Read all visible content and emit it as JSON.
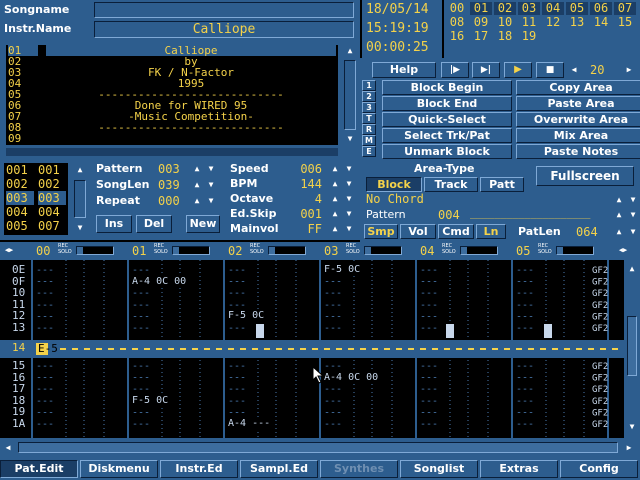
{
  "header": {
    "songname_label": "Songname",
    "instrname_label": "Instr.Name",
    "instr_name_value": "Calliope",
    "date": "18/05/14",
    "time": "15:19:19",
    "elapsed": "00:00:25",
    "channels_row1": [
      "00",
      "01",
      "02",
      "03",
      "04",
      "05",
      "06",
      "07"
    ],
    "channels_row2": [
      "08",
      "09",
      "10",
      "11",
      "12",
      "13",
      "14",
      "15"
    ],
    "channels_row3": [
      "16",
      "17",
      "18",
      "19"
    ],
    "channels_active": [
      "01",
      "02",
      "03",
      "04",
      "05",
      "06",
      "07"
    ]
  },
  "instruments": {
    "numbers": [
      "01",
      "02",
      "03",
      "04",
      "05",
      "06",
      "07",
      "08",
      "09"
    ],
    "lines": [
      "Calliope",
      "by",
      "FK / N-Factor",
      "1995",
      "----------------------------",
      "Done for WIRED 95",
      "-Music Competition-",
      "----------------------------",
      ""
    ]
  },
  "transport": {
    "help_label": "Help",
    "value": "20"
  },
  "block_panel": {
    "side_tabs": [
      "1",
      "2",
      "3",
      "T",
      "R",
      "M",
      "E"
    ],
    "buttons": [
      [
        "Block Begin",
        "Copy Area"
      ],
      [
        "Block End",
        "Paste Area"
      ],
      [
        "Quick-Select",
        "Overwrite Area"
      ],
      [
        "Select Trk/Pat",
        "Mix Area"
      ],
      [
        "Unmark Block",
        "Paste Notes"
      ]
    ]
  },
  "pattern_list": {
    "cells": [
      [
        "001",
        "001"
      ],
      [
        "002",
        "002"
      ],
      [
        "003",
        "003"
      ],
      [
        "004",
        "004"
      ],
      [
        "005",
        "007"
      ]
    ]
  },
  "song_params": {
    "pattern_label": "Pattern",
    "pattern_value": "003",
    "songlen_label": "SongLen",
    "songlen_value": "039",
    "repeat_label": "Repeat",
    "repeat_value": "000",
    "ins_label": "Ins",
    "del_label": "Del",
    "new_label": "New"
  },
  "play_params": {
    "speed_label": "Speed",
    "speed_value": "006",
    "bpm_label": "BPM",
    "bpm_value": "144",
    "octave_label": "Octave",
    "octave_value": "4",
    "edskip_label": "Ed.Skip",
    "edskip_value": "001",
    "mainvol_label": "Mainvol",
    "mainvol_value": "FF"
  },
  "area_type": {
    "title": "Area-Type",
    "options": [
      "Block",
      "Track",
      "Patt"
    ],
    "selected": "Block",
    "fullscreen_label": "Fullscreen"
  },
  "chord": {
    "chord_text": "No Chord",
    "pattern_label": "Pattern",
    "pattern_value": "004",
    "pattern_name": "____________________"
  },
  "edit_modes": {
    "modes": [
      "Smp",
      "Vol",
      "Cmd",
      "Ln"
    ],
    "active": [
      "Smp",
      "Ln"
    ],
    "patlen_label": "PatLen",
    "patlen_value": "064"
  },
  "tracks": {
    "headers": [
      "00",
      "01",
      "02",
      "03",
      "04",
      "05"
    ],
    "rec_label": "REC",
    "solo_label": "SOLO",
    "current_row": "14",
    "current_note": "E-5",
    "rows": [
      "0E",
      "0F",
      "10",
      "11",
      "12",
      "13",
      "14",
      "15",
      "16",
      "17",
      "18",
      "19",
      "1A"
    ],
    "notes": [
      {
        "row": 1,
        "track": 1,
        "text": "A-4 0C 00"
      },
      {
        "row": 4,
        "track": 2,
        "text": "F-5 0C"
      },
      {
        "row": -1,
        "track": 3,
        "text": "F-5 0C"
      },
      {
        "row": 8,
        "track": 3,
        "text": "A-4 0C 00"
      },
      {
        "row": 10,
        "track": 1,
        "text": "F-5 0C"
      },
      {
        "row": 12,
        "track": 2,
        "text": "A-4 ---"
      }
    ],
    "right_column_text": "GF2"
  },
  "bottom_tabs": [
    "Pat.Edit",
    "Diskmenu",
    "Instr.Ed",
    "Sampl.Ed",
    "Synthes",
    "Songlist",
    "Extras",
    "Config"
  ],
  "bottom_active": "Pat.Edit",
  "bottom_disabled": "Synthes"
}
